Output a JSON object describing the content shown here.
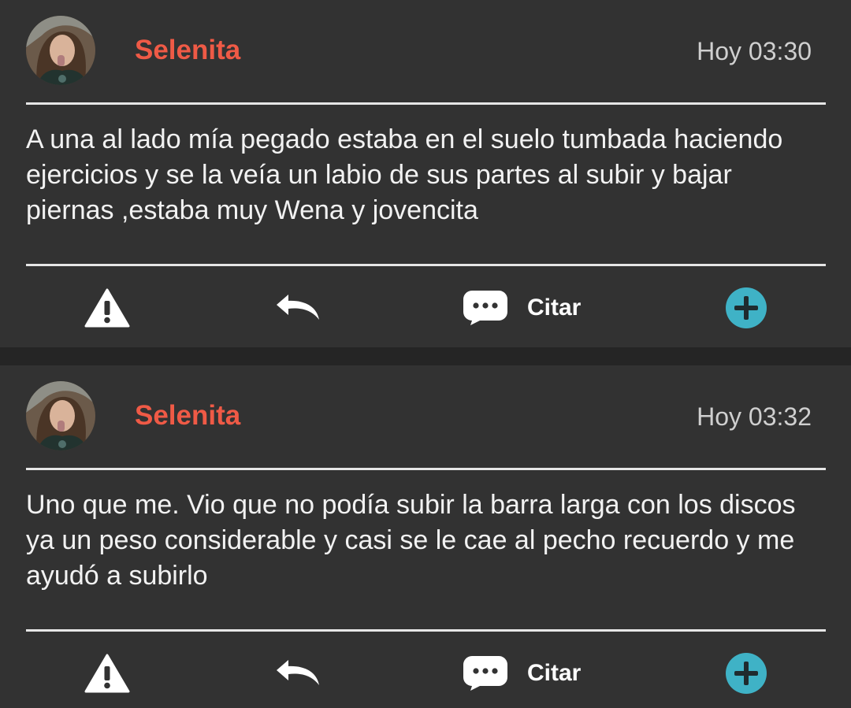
{
  "posts": [
    {
      "author": "Selenita",
      "time": "Hoy 03:30",
      "body": "A una al lado mía pegado estaba en el suelo tumbada haciendo ejercicios y se la veía un labio de sus partes al subir y bajar piernas ,estaba muy Wena y jovencita",
      "actions": {
        "report_icon": "warning-icon",
        "reply_icon": "reply-arrow-icon",
        "quote_icon": "chat-bubble-icon",
        "quote_label": "Citar",
        "add_icon": "plus-circle-icon"
      }
    },
    {
      "author": "Selenita",
      "time": "Hoy 03:32",
      "body": "Uno que me. Vio que no podía subir la barra larga con los discos ya un peso considerable y casi se le cae al pecho recuerdo y me ayudó a subirlo",
      "actions": {
        "report_icon": "warning-icon",
        "reply_icon": "reply-arrow-icon",
        "quote_icon": "chat-bubble-icon",
        "quote_label": "Citar",
        "add_icon": "plus-circle-icon"
      }
    }
  ],
  "colors": {
    "background": "#323232",
    "separator": "#252525",
    "author": "#ef5a46",
    "text": "#f2f2f2",
    "timestamp": "#cfcfcf",
    "accent": "#3fb2c6"
  }
}
